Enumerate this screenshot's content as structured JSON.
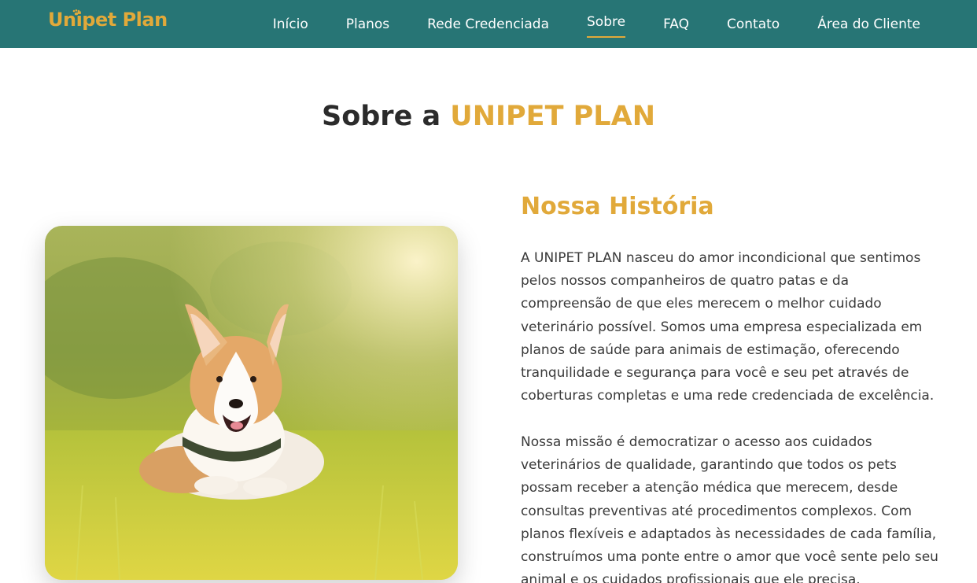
{
  "nav": {
    "logo": "Unipet Plan",
    "links": [
      "Início",
      "Planos",
      "Rede Credenciada",
      "Sobre",
      "FAQ",
      "Contato",
      "Área do Cliente"
    ],
    "active_index": 3
  },
  "section": {
    "title_prefix": "Sobre a ",
    "title_accent": "UNIPET PLAN"
  },
  "history": {
    "heading": "Nossa História",
    "paragraph1": "A UNIPET PLAN nasceu do amor incondicional que sentimos pelos nossos companheiros de quatro patas e da compreensão de que eles merecem o melhor cuidado veterinário possível. Somos uma empresa especializada em planos de saúde para animais de estimação, oferecendo tranquilidade e segurança para você e seu pet através de coberturas completas e uma rede credenciada de excelência.",
    "paragraph2": "Nossa missão é democratizar o acesso aos cuidados veterinários de qualidade, garantindo que todos os pets possam receber a atenção médica que merecem, desde consultas preventivas até procedimentos complexos. Com planos flexíveis e adaptados às necessidades de cada família, construímos uma ponte entre o amor que você sente pelo seu animal e os cuidados profissionais que ele precisa."
  },
  "image": {
    "subject": "corgi-dog-on-grass-photo"
  },
  "colors": {
    "nav_bg": "#277575",
    "accent": "#e1a93a",
    "heading_dark": "#2b2b2b",
    "body_text": "#3a3a3a"
  }
}
